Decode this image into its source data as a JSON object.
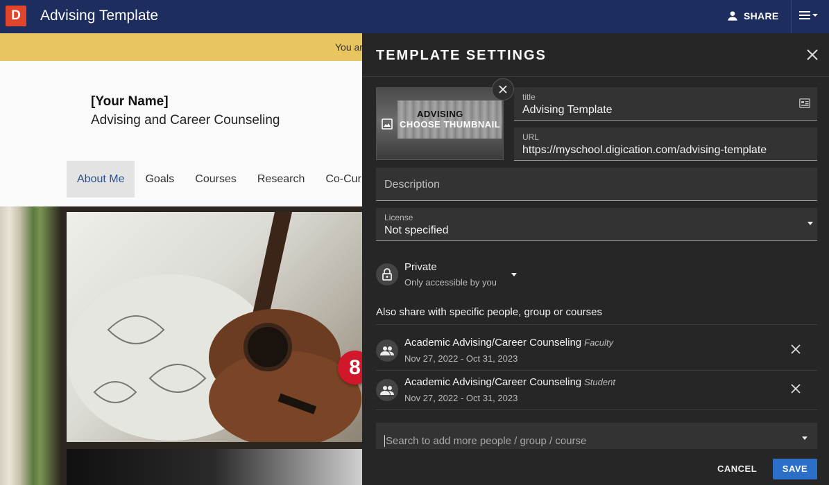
{
  "app": {
    "logo_letter": "D",
    "title": "Advising Template",
    "share_label": "SHARE",
    "brand_color": "#1d2d5e",
    "logo_color": "#e1452b"
  },
  "page": {
    "banner_text": "You ar",
    "banner_color": "#e8c55f",
    "your_name": "[Your Name]",
    "subtitle": "Advising and Career Counseling",
    "nav": [
      {
        "label": "About Me",
        "active": true
      },
      {
        "label": "Goals",
        "active": false
      },
      {
        "label": "Courses",
        "active": false
      },
      {
        "label": "Research",
        "active": false
      },
      {
        "label": "Co-Curr",
        "active": false
      }
    ],
    "step_badge": "8"
  },
  "panel": {
    "title": "TEMPLATE SETTINGS",
    "thumbnail": {
      "preview_text": "ADVISING",
      "choose_label": "CHOOSE THUMBNAIL"
    },
    "title_field": {
      "label": "title",
      "value": "Advising Template"
    },
    "url_field": {
      "label": "URL",
      "value": "https://myschool.digication.com/advising-template"
    },
    "description_field": {
      "placeholder": "Description"
    },
    "license_field": {
      "label": "License",
      "value": "Not specified"
    },
    "privacy": {
      "title": "Private",
      "subtitle": "Only accessible by you"
    },
    "also_share_label": "Also share with specific people, group or courses",
    "shares": [
      {
        "name": "Academic Advising/Career Counseling",
        "role": "Faculty",
        "dates": "Nov 27, 2022 - Oct 31, 2023"
      },
      {
        "name": "Academic Advising/Career Counseling",
        "role": "Student",
        "dates": "Nov 27, 2022 - Oct 31, 2023"
      }
    ],
    "search_placeholder": "Search to add more people / group / course",
    "cancel_label": "CANCEL",
    "save_label": "SAVE",
    "save_color": "#2b6fc9"
  }
}
